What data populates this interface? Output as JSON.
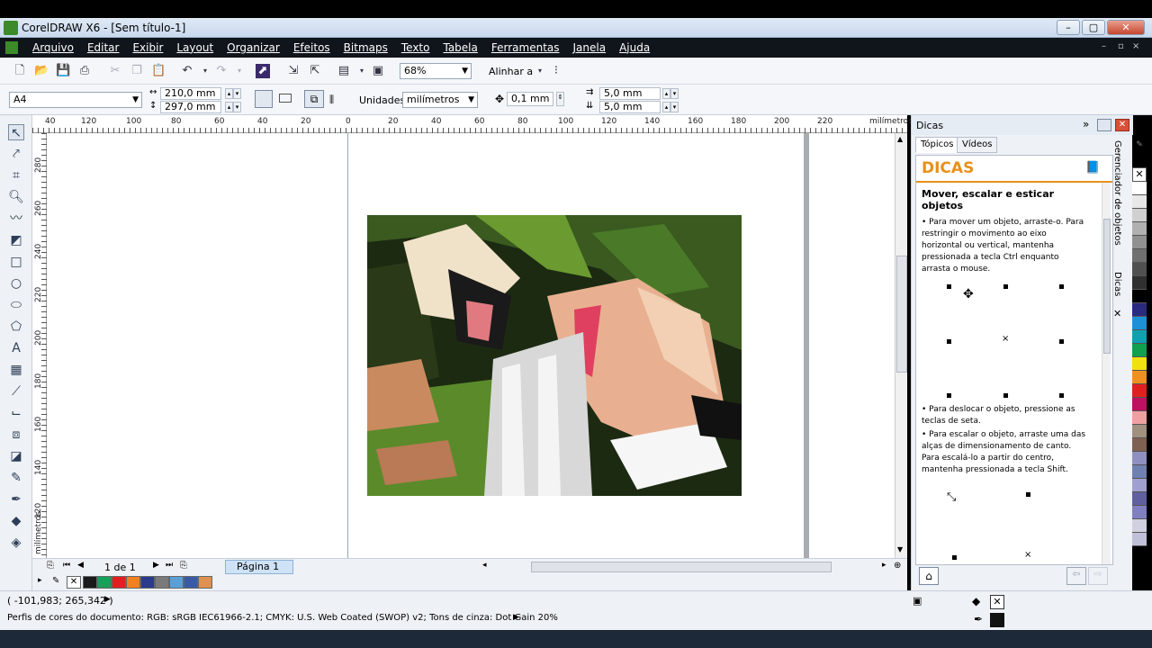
{
  "window": {
    "title": "CorelDRAW X6 - [Sem título-1]",
    "controls": [
      "–",
      "▢",
      "✕"
    ],
    "mdi_controls": [
      "–",
      "▫",
      "×"
    ]
  },
  "menu": [
    "Arquivo",
    "Editar",
    "Exibir",
    "Layout",
    "Organizar",
    "Efeitos",
    "Bitmaps",
    "Texto",
    "Tabela",
    "Ferramentas",
    "Janela",
    "Ajuda"
  ],
  "toolbar": {
    "zoom": "68%",
    "align_label": "Alinhar a"
  },
  "propbar": {
    "paper_size": "A4",
    "width": "210,0 mm",
    "height": "297,0 mm",
    "units_label": "Unidades:",
    "units_value": "milímetros",
    "nudge": "0,1 mm",
    "dup_x": "5,0 mm",
    "dup_y": "5,0 mm"
  },
  "ruler": {
    "top_ticks": [
      "40",
      "120",
      "100",
      "80",
      "60",
      "40",
      "20",
      "0",
      "20",
      "40",
      "60",
      "80",
      "100",
      "120",
      "140",
      "160",
      "180",
      "200",
      "220"
    ],
    "top_unit": "milímetros",
    "left_ticks": [
      "280",
      "260",
      "240",
      "220",
      "200",
      "180",
      "160",
      "140",
      "120"
    ],
    "left_unit": "milímetros"
  },
  "pagenav": {
    "counter": "1 de 1",
    "page_tab": "Página 1"
  },
  "status": {
    "coords": "( -101,983; 265,342 )",
    "profile": "Perfis de cores do documento: RGB: sRGB IEC61966-2.1; CMYK: U.S. Web Coated (SWOP) v2; Tons de cinza: Dot Gain 20%"
  },
  "docker": {
    "title": "Dicas",
    "tabs": [
      "Tópicos",
      "Vídeos"
    ],
    "heading": "DICAS",
    "topic_title": "Mover, escalar e esticar objetos",
    "bullets": [
      "Para mover um objeto, arraste-o. Para restringir o movimento ao eixo horizontal ou vertical, mantenha pressionada a tecla Ctrl enquanto arrasta o mouse.",
      "Para deslocar o objeto, pressione as teclas de seta.",
      "Para escalar o objeto, arraste uma das alças de dimensionamento de canto. Para escalá-lo a partir do centro, mantenha pressionada a tecla Shift."
    ],
    "side_tabs": [
      "Gerenciador de objetos",
      "Dicas"
    ]
  },
  "colors": {
    "bottom_palette": [
      "#1a1a1a",
      "#16a05a",
      "#e02020",
      "#f08020",
      "#2a3a8c",
      "#7a7a7a",
      "#5aa0d8",
      "#3a5aa8",
      "#e09050"
    ],
    "right_palette": [
      "#ffffff",
      "#e8e8e8",
      "#d0d0d0",
      "#b0b0b0",
      "#909090",
      "#707070",
      "#505050",
      "#303030",
      "#000000",
      "#2a2a80",
      "#1e90d8",
      "#10a0b0",
      "#10a050",
      "#f0e010",
      "#f09020",
      "#e02020",
      "#c01060",
      "#f0a0a0",
      "#a09080",
      "#806050",
      "#9090c0",
      "#7080b0",
      "#a0a0d0",
      "#6060a0",
      "#8080c0",
      "#d0d0e0",
      "#c0c0d8"
    ]
  }
}
